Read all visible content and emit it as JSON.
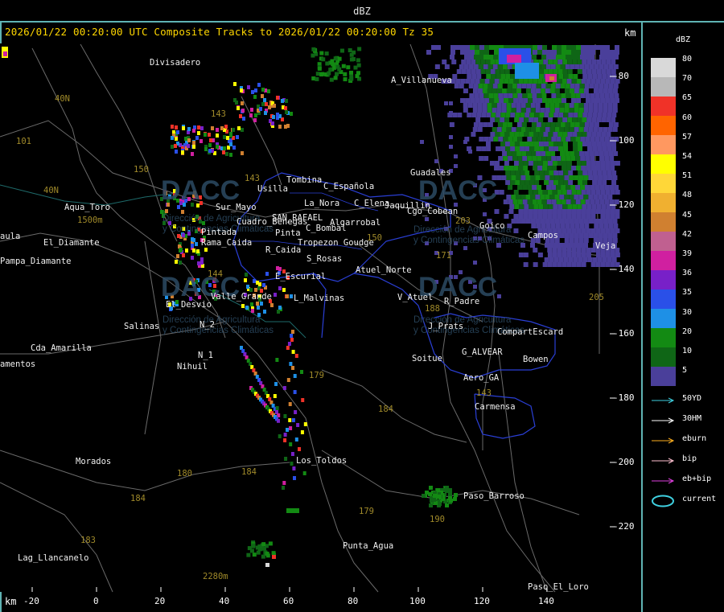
{
  "header": {
    "title": "dBZ"
  },
  "map": {
    "subtitle": "2026/01/22 00:20:00 UTC Composite Tracks to 2026/01/22 00:20:00 Tz 35",
    "axis_unit": "km",
    "x_ticks": [
      "-20",
      "0",
      "20",
      "40",
      "60",
      "80",
      "100",
      "120",
      "140"
    ],
    "y_ticks": [
      "-80",
      "-100",
      "-120",
      "-140",
      "-160",
      "-180",
      "-200",
      "-220"
    ],
    "places": [
      "Divisadero",
      "A_Villanueva",
      "La_Nora",
      "C_Española",
      "C_Elena",
      "Usilla",
      "Tombina",
      "Guadales",
      "Aqua_Toro",
      "Sur_Mayo",
      "Cuadro_Benegas",
      "SAN_RAFAEL",
      "Algarrobal",
      "C_Bombal",
      "Pinta",
      "Pintada",
      "R_Caida",
      "Tropezon Goudge",
      "Rama_Caida",
      "S_Rosas",
      "Atuel_Norte",
      "E_Escurial",
      "Valle_Grande",
      "L_Malvinas",
      "El_Desvio",
      "V_Atuel",
      "R_Padre",
      "Salinas",
      "N_2",
      "J_Prats",
      "CompartEscard",
      "G_ALVEAR",
      "Cda_Amarilla",
      "N_1",
      "Soitue",
      "Bowen",
      "Nihuil",
      "Aero_GA",
      "amentos",
      "Carmensa",
      "Los_Toldos",
      "Morados",
      "Paso_Barroso",
      "Punta_Agua",
      "Lag_Llancanelo",
      "Paso_El_Loro",
      "aula",
      "Pampa_Diamante",
      "Goico",
      "Cgo_Cobean",
      "El_Diamante",
      "Jaquillin",
      "Campos",
      "Veja"
    ],
    "routes": [
      "40N",
      "101",
      "40N",
      "143",
      "150",
      "144",
      "143",
      "150",
      "179",
      "184",
      "180",
      "184",
      "183",
      "179",
      "190",
      "143",
      "171",
      "203",
      "188",
      "205",
      "184"
    ],
    "elevations": [
      "1500m",
      "2280m"
    ],
    "watermark": {
      "brand": "DACC",
      "line1": "Dirección de Agricultura",
      "line2": "y Contingencias Climáticas"
    }
  },
  "legend": {
    "unit": "dBZ",
    "scale": [
      {
        "value": "80",
        "color": "#d9d9d9"
      },
      {
        "value": "70",
        "color": "#b8b8b8"
      },
      {
        "value": "65",
        "color": "#f03228"
      },
      {
        "value": "60",
        "color": "#ff6400"
      },
      {
        "value": "57",
        "color": "#ff9860"
      },
      {
        "value": "54",
        "color": "#ffff00"
      },
      {
        "value": "51",
        "color": "#ffd738"
      },
      {
        "value": "48",
        "color": "#f0b030"
      },
      {
        "value": "45",
        "color": "#d08030"
      },
      {
        "value": "42",
        "color": "#c06090"
      },
      {
        "value": "39",
        "color": "#d020a0"
      },
      {
        "value": "36",
        "color": "#7820c8"
      },
      {
        "value": "35",
        "color": "#2a50e8"
      },
      {
        "value": "30",
        "color": "#1e90e6"
      },
      {
        "value": "20",
        "color": "#138a13"
      },
      {
        "value": "10",
        "color": "#0f6616"
      },
      {
        "value": "5",
        "color": "#4a3f9a"
      }
    ],
    "tracks": [
      {
        "label": "50YD",
        "color": "#3fd0e0"
      },
      {
        "label": "30HM",
        "color": "#ffffff"
      },
      {
        "label": "eburn",
        "color": "#ffb020"
      },
      {
        "label": "bip",
        "color": "#ffc0d0"
      },
      {
        "label": "eb+bip",
        "color": "#e040e0"
      },
      {
        "label": "current",
        "color": "#3fd0e0"
      }
    ]
  }
}
